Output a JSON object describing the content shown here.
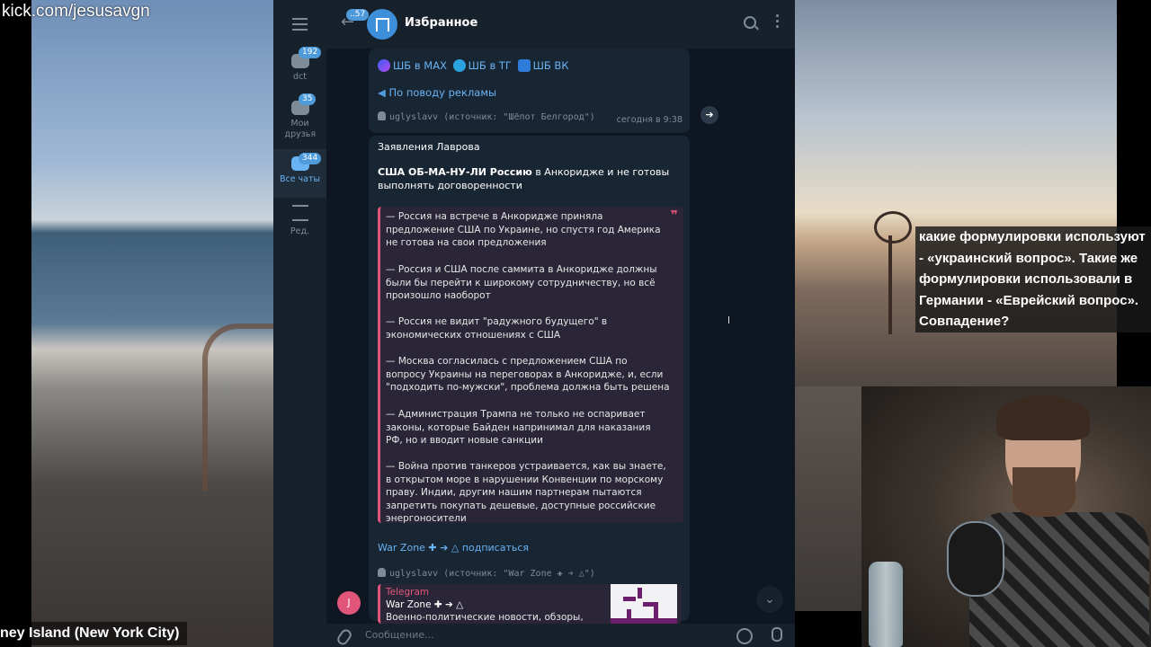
{
  "stream": {
    "watermark": "kick.com/jesusavgn",
    "location": "ney Island (New York City)",
    "overlay_text": "какие формулировки используют - «украинский вопрос». Такие же формулировки использовали в Германии - «Еврейский вопрос». Совпадение?"
  },
  "folders": [
    {
      "label": "dct",
      "badge": "192"
    },
    {
      "label": "Мои друзья",
      "badge": "35"
    },
    {
      "label": "Все чаты",
      "badge": "344"
    },
    {
      "label": "Ред.",
      "badge": ""
    }
  ],
  "header": {
    "back_badge": "..57",
    "title": "Избранное"
  },
  "msg1": {
    "links": [
      "ШБ в MAX",
      "ШБ в ТГ",
      "ШБ ВК"
    ],
    "ads": "По поводу рекламы",
    "forwarded": "uglyslavv (источник: \"Шёпот Белгород\")",
    "time": "сегодня в 9:38"
  },
  "msg2": {
    "title": "Заявления Лаврова",
    "lead_bold": "США ОБ-МА-НУ-ЛИ Россию",
    "lead_rest": " в Анкоридже и не готовы выполнять договоренности",
    "quotes": [
      "— Россия на встрече в Анкоридже приняла предложение США по Украине, но спустя год Америка не готова на свои предложения",
      "— Россия и США после саммита в Анкоридже должны были бы перейти к широкому сотрудничеству, но всё произошло наоборот",
      "— Россия не видит \"радужного будущего\" в экономических отношениях с США",
      "— Москва согласилась с предложением США по вопросу Украины на переговорах в Анкоридже, и, если \"подходить по-мужски\", проблема должна быть решена",
      "— Администрация Трампа не только не оспаривает законы, которые Байден напринимал для наказания РФ, но и вводит новые санкции",
      "— Война против танкеров устраивается, как вы знаете, в открытом море в нарушении Конвенции по морскому праву. Индии, другим нашим партнерам пытаются запретить покупать дешевые, доступные российские энергоносители"
    ],
    "channel": "War Zone ✚ ➔ △ подписаться",
    "forwarded": "uglyslavv (источник: \"War Zone ✚ ➔ △\")",
    "preview": {
      "site": "Telegram",
      "title": "War Zone ✚ ➔ △",
      "desc": "Военно-политические новости, обзоры,"
    }
  },
  "avatar_letter": "J",
  "composer": {
    "placeholder": "Сообщение..."
  },
  "colors": {
    "accent": "#6ab3f3",
    "quote_bar": "#e2557b",
    "bg": "#0e1621",
    "panel": "#17212b"
  }
}
